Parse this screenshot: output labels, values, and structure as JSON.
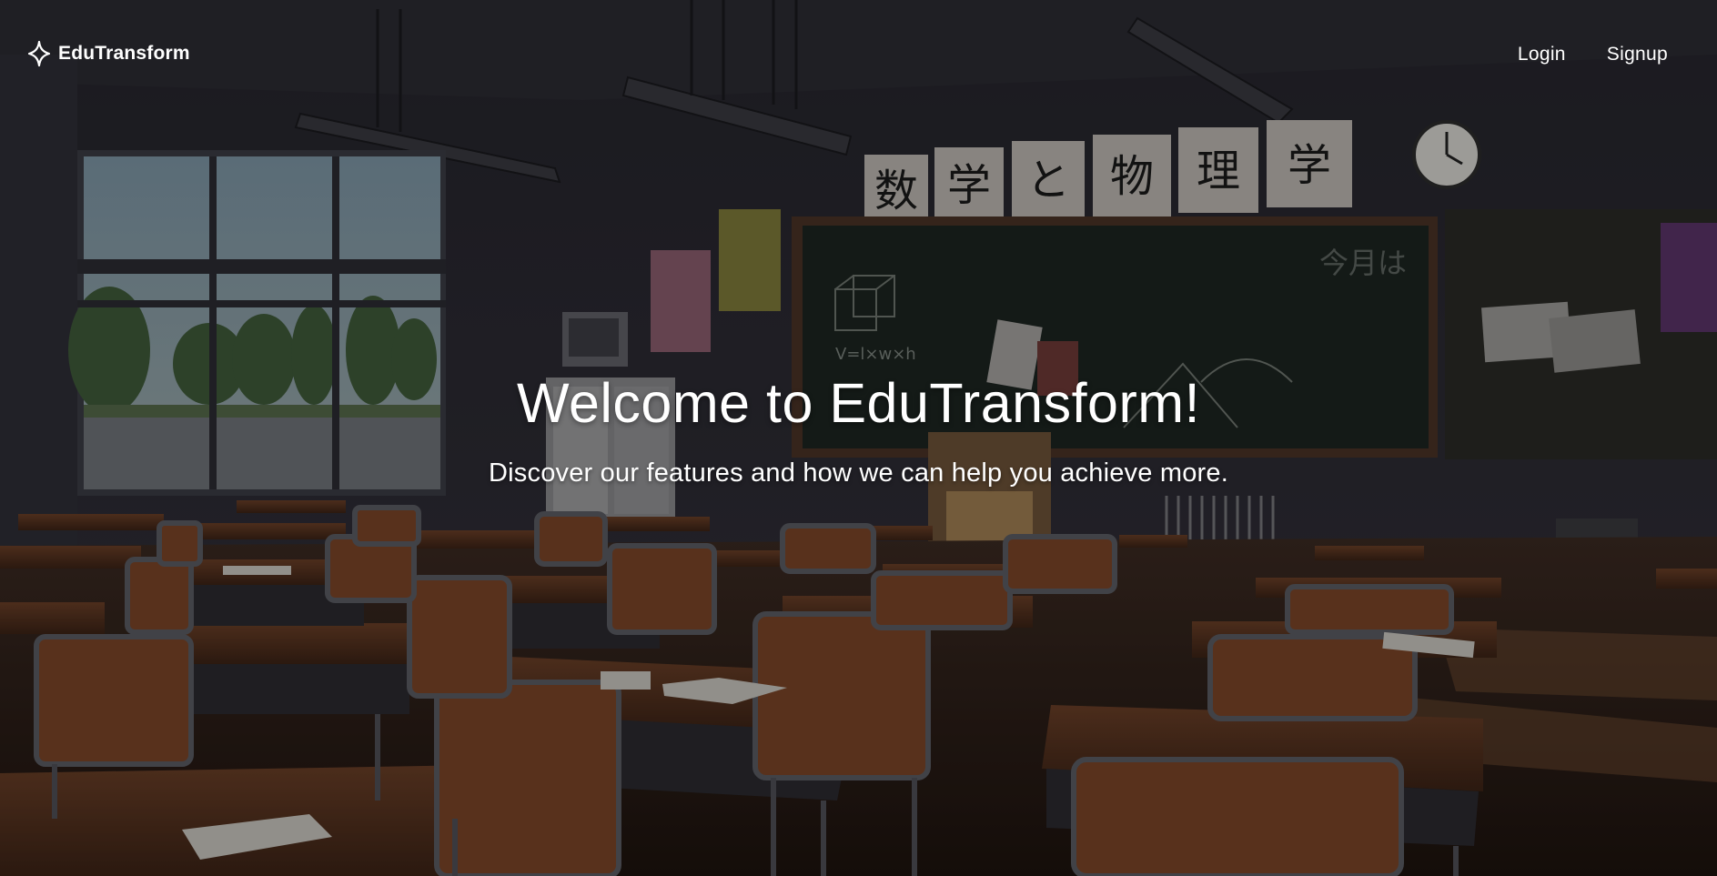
{
  "navbar": {
    "brand_name": "EduTransform",
    "brand_icon": "sparkle-icon",
    "links": {
      "login": "Login",
      "signup": "Signup"
    }
  },
  "hero": {
    "title": "Welcome to EduTransform!",
    "subtitle": "Discover our features and how we can help you achieve more."
  },
  "background": {
    "chalkboard_banner": [
      "数",
      "学",
      "と",
      "物",
      "理",
      "学"
    ],
    "colors": {
      "wall": "#2b2a33",
      "floor": "#3a2418",
      "desk_top": "#5a3522",
      "chalkboard": "#1c211f",
      "window_sky": "#8fa6b5",
      "text": "#ffffff"
    }
  }
}
